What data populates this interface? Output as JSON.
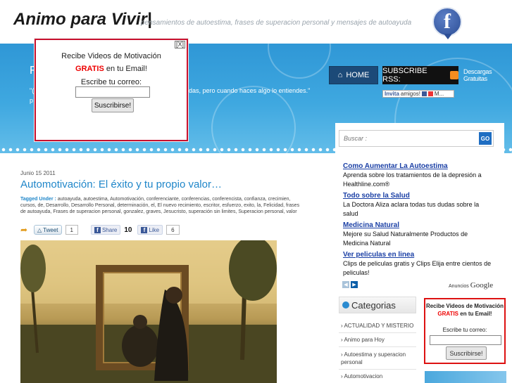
{
  "header": {
    "site_title": "Animo para Vivir|",
    "tagline": "pensamientos de autoestima, frases de superacion personal y mensajes de autoayuda",
    "facebook_glyph": "f"
  },
  "banner": {
    "quote_initial": "F",
    "quote_line_a": "\"(",
    "quote_line_b": "p",
    "quote_line_c": "das, pero cuando haces algo lo entiendes.\""
  },
  "nav": {
    "home": "HOME",
    "subscribe_rss": "SUBSCRIBE RSS:",
    "descargas": "Descargas Gratuitas",
    "invita": "Invita",
    "invita_rest": "amigos!",
    "invita_tail": "M..."
  },
  "popup": {
    "close": "[X]",
    "title": "Recibe Videos de Motivación",
    "gratis": "GRATIS",
    "line2_rest": " en tu Email!",
    "label": "Escribe tu correo:",
    "button": "Suscribirse!",
    "email_value": ""
  },
  "post": {
    "date": "Junio 15 2011",
    "title": "Automotivación: El éxito y tu propio valor…",
    "tags_label": "Tagged Under :",
    "tags": " autoayuda, autoestima, Automotivación, conferenciante, conferencias, conferencista, confianza, crecimien, cursos, de, Desarrollo, Desarrollo Personal, determinación, el, El nuevo recimiento, escritor, esfuerzo, exito, la, Felicidad, frases de autoayuda, Frases de superacion personal, gonzalez, graves, Jesucristo, superación sin limites, Superacion personal, valor",
    "tweet": "Tweet",
    "tweet_count": "1",
    "share": "Share",
    "share_count": "10",
    "like": "Like",
    "like_count": "6"
  },
  "sidebar": {
    "search_placeholder": "Buscar :",
    "search_go": "GO",
    "ads": [
      {
        "title": "Como Aumentar La Autoestima",
        "text": "Aprenda sobre los tratamientos de la depresión a Healthline.com®"
      },
      {
        "title": "Todo sobre la Salud",
        "text": "La Doctora Aliza aclara todas tus dudas sobre la salud"
      },
      {
        "title": "Medicina Natural",
        "text": "Mejore su Salud Naturalmente Productos de Medicina Natural"
      },
      {
        "title": "Ver peliculas en linea",
        "text": "Clips de peliculas gratis y Clips Elija entre cientos de peliculas!"
      }
    ],
    "ads_by": "Anuncios",
    "ads_brand": "Google",
    "categories_title": "Categorias",
    "categories": [
      "ACTUALIDAD Y MISTERIO",
      "Animo para Hoy",
      "Autoestima y superacion personal",
      "Automotivacion"
    ],
    "subscribe": {
      "line1": "Recibe Videos de Motivación",
      "gratis": "GRATIS",
      "line2": " en tu Email!",
      "label": "Escribe tu correo:",
      "button": "Suscribirse!"
    }
  }
}
